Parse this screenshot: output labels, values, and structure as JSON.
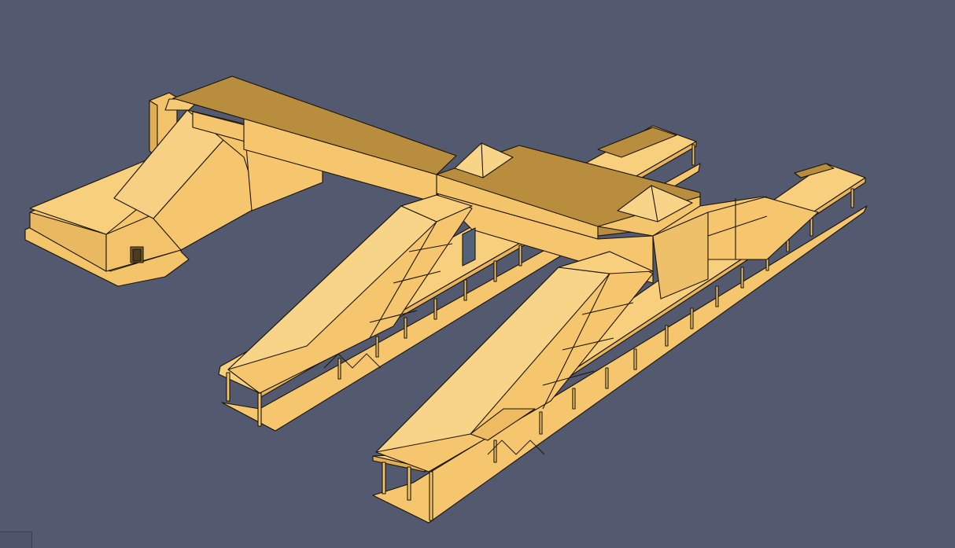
{
  "viewport": {
    "background_color": "#535a70",
    "model_fill": "#f5c66e",
    "model_fill_light": "#f8d489",
    "model_fill_dark": "#e2ae55",
    "model_roof": "#b88d3e",
    "edge_color": "#1a1408"
  },
  "corner_widget": {
    "icon": "view-cube-icon"
  }
}
